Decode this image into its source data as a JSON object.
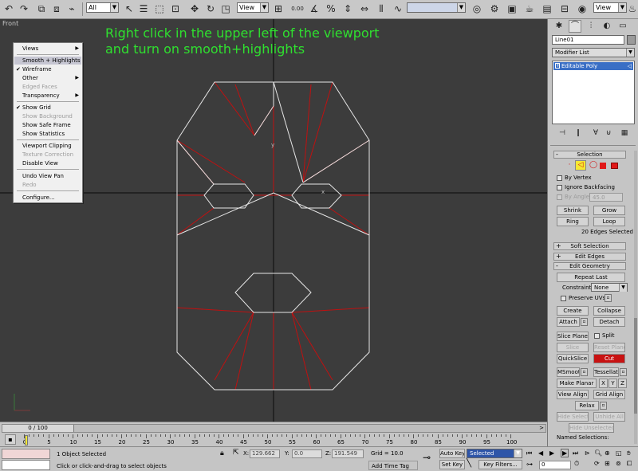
{
  "toolbar": {
    "selection_filter": "All",
    "ref_coord": "View",
    "snap_value": "0.00",
    "named_selection": "",
    "render_view": "View",
    "icons": [
      "undo-icon",
      "redo-icon",
      "link-icon",
      "unlink-icon",
      "bind-space-warp-icon",
      "select-by-name-icon",
      "select-object-icon",
      "rect-region-icon",
      "window-crossing-icon",
      "move-icon",
      "rotate-icon",
      "scale-icon",
      "pivot-icon",
      "snaps-icon",
      "angle-snap-icon",
      "percent-snap-icon",
      "spinner-snap-icon",
      "mirror-icon",
      "align-icon",
      "curve-editor-icon",
      "material-editor-icon",
      "render-setup-icon",
      "render-frame-icon",
      "quick-render-icon"
    ]
  },
  "viewport": {
    "label": "Front",
    "instruction_line1": "Right click in the upper left of the viewport",
    "instruction_line2": "and turn on smooth+highlights",
    "axis_x": "x",
    "axis_y": "y",
    "colors": {
      "background": "#3c3c3c",
      "edges_white": "#e6e6e6",
      "edges_red": "#c01010",
      "grid": "#0a0a0a",
      "instruction": "#2fe02f"
    }
  },
  "context_menu": {
    "items": [
      {
        "label": "Views",
        "submenu": true,
        "checked": false,
        "disabled": false,
        "highlighted": false
      },
      {
        "label": "Smooth + Highlights",
        "submenu": false,
        "checked": false,
        "disabled": false,
        "highlighted": true
      },
      {
        "label": "Wireframe",
        "submenu": false,
        "checked": true,
        "disabled": false,
        "highlighted": false
      },
      {
        "label": "Other",
        "submenu": true,
        "checked": false,
        "disabled": false,
        "highlighted": false
      },
      {
        "label": "Edged Faces",
        "submenu": false,
        "checked": false,
        "disabled": true,
        "highlighted": false
      },
      {
        "label": "Transparency",
        "submenu": true,
        "checked": false,
        "disabled": false,
        "highlighted": false
      },
      {
        "label": "Show Grid",
        "submenu": false,
        "checked": true,
        "disabled": false,
        "highlighted": false
      },
      {
        "label": "Show Background",
        "submenu": false,
        "checked": false,
        "disabled": true,
        "highlighted": false
      },
      {
        "label": "Show Safe Frame",
        "submenu": false,
        "checked": false,
        "disabled": false,
        "highlighted": false
      },
      {
        "label": "Show Statistics",
        "submenu": false,
        "checked": false,
        "disabled": false,
        "highlighted": false
      },
      {
        "label": "Viewport Clipping",
        "submenu": false,
        "checked": false,
        "disabled": false,
        "highlighted": false
      },
      {
        "label": "Texture Correction",
        "submenu": false,
        "checked": false,
        "disabled": true,
        "highlighted": false
      },
      {
        "label": "Disable View",
        "submenu": false,
        "checked": false,
        "disabled": false,
        "highlighted": false
      },
      {
        "label": "Undo View Pan",
        "submenu": false,
        "checked": false,
        "disabled": false,
        "highlighted": false
      },
      {
        "label": "Redo",
        "submenu": false,
        "checked": false,
        "disabled": true,
        "highlighted": false
      },
      {
        "label": "Configure...",
        "submenu": false,
        "checked": false,
        "disabled": false,
        "highlighted": false
      }
    ]
  },
  "panel": {
    "object_name": "Line01",
    "modifier_list": "Modifier List",
    "stack_item": "Editable Poly",
    "selection": {
      "title": "Selection",
      "by_vertex": "By Vertex",
      "ignore_backfacing": "Ignore Backfacing",
      "by_angle": "By Angle:",
      "angle_value": "45.0",
      "shrink": "Shrink",
      "grow": "Grow",
      "ring": "Ring",
      "loop": "Loop",
      "status": "20 Edges Selected"
    },
    "soft_selection": "Soft Selection",
    "edit_edges": "Edit Edges",
    "edit_geometry": {
      "title": "Edit Geometry",
      "repeat_last": "Repeat Last",
      "constraints_label": "Constraints:",
      "constraints_value": "None",
      "preserve_uvs": "Preserve UVs",
      "create": "Create",
      "collapse": "Collapse",
      "attach": "Attach",
      "detach": "Detach",
      "slice_plane": "Slice Plane",
      "split": "Split",
      "slice": "Slice",
      "reset_plane": "Reset Plane",
      "quickslice": "QuickSlice",
      "cut": "Cut",
      "msmooth": "MSmooth",
      "tessellate": "Tessellate",
      "make_planar": "Make Planar",
      "x": "X",
      "y": "Y",
      "z": "Z",
      "view_align": "View Align",
      "grid_align": "Grid Align",
      "relax": "Relax",
      "hide_selected": "Hide Selected",
      "unhide_all": "Unhide All",
      "hide_unselected": "Hide Unselected",
      "named_selections": "Named Selections:"
    },
    "colors": {
      "yellow_active": "#f5e832",
      "red_element": "#e01818",
      "cut_red": "#c81212",
      "stack_highlight": "#3a6fc5"
    }
  },
  "timeline": {
    "frame_display": "0 / 100",
    "ticks": [
      "0",
      "5",
      "10",
      "15",
      "20",
      "25",
      "30",
      "35",
      "40",
      "45",
      "50",
      "55",
      "60",
      "65",
      "70",
      "75",
      "80",
      "85",
      "90",
      "95",
      "100"
    ]
  },
  "status": {
    "objects_selected": "1 Object Selected",
    "prompt": "Click or click-and-drag to select objects",
    "x_label": "X:",
    "x_value": "129.662",
    "y_label": "Y:",
    "y_value": "0.0",
    "z_label": "Z:",
    "z_value": "191.549",
    "grid": "Grid = 10.0",
    "add_time_tag": "Add Time Tag",
    "auto_key": "Auto Key",
    "set_key": "Set Key",
    "selected_dropdown": "Selected",
    "key_filters": "Key Filters...",
    "current_frame": "0"
  }
}
